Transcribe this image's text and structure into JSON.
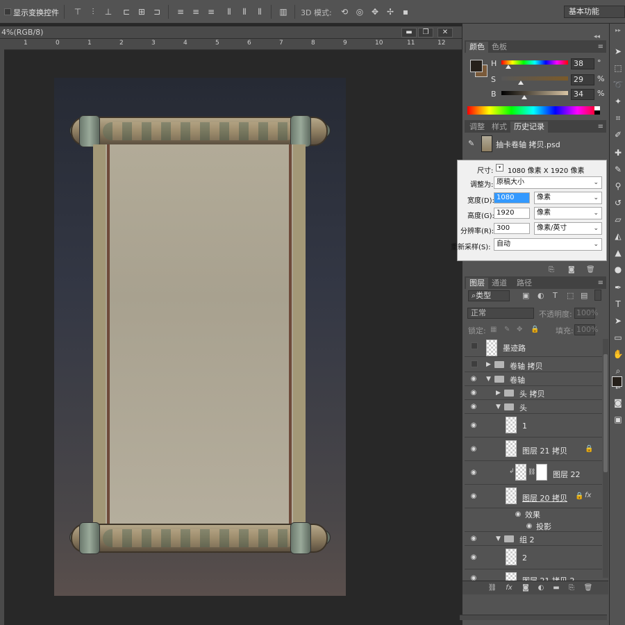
{
  "options_bar": {
    "show_transform_label": "显示变换控件",
    "mode_3d_label": "3D 模式:",
    "workspace": "基本功能"
  },
  "document": {
    "title_fragment": "4%(RGB/8)",
    "ruler_numbers": [
      "1",
      "0",
      "1",
      "2",
      "3",
      "4",
      "5",
      "6",
      "7",
      "8",
      "9",
      "10",
      "11",
      "12"
    ],
    "window_buttons": [
      "▬",
      "❐",
      "✕"
    ]
  },
  "color_panel": {
    "tabs": [
      "颜色",
      "色板"
    ],
    "sliders": [
      {
        "label": "H",
        "value": "38",
        "unit": "°",
        "position": 0.1
      },
      {
        "label": "S",
        "value": "29",
        "unit": "%",
        "position": 0.29
      },
      {
        "label": "B",
        "value": "34",
        "unit": "%",
        "position": 0.34
      }
    ],
    "foreground_color": "#26201a",
    "background_color": "#7a5a3a"
  },
  "history_panel": {
    "tabs": [
      "调整",
      "样式",
      "历史记录"
    ],
    "item": "抽卡卷轴 拷贝.psd"
  },
  "image_size_dialog": {
    "size_label": "尺寸:",
    "size_value": "1080 像素  X  1920 像素",
    "fit_label": "调整为:",
    "fit_value": "原稿大小",
    "width_label": "宽度(D):",
    "width_value": "1080",
    "width_unit": "像素",
    "height_label": "高度(G):",
    "height_value": "1920",
    "height_unit": "像素",
    "resolution_label": "分辨率(R):",
    "resolution_value": "300",
    "resolution_unit": "像素/英寸",
    "resample_label": "重新采样(S):",
    "resample_value": "自动"
  },
  "layers_panel": {
    "tabs": [
      "图层",
      "通道",
      "路径"
    ],
    "filter_label": "类型",
    "blend_mode": "正常",
    "opacity_label": "不透明度:",
    "opacity_value": "100%",
    "lock_label": "锁定:",
    "fill_label": "填充:",
    "fill_value": "100%",
    "layers": [
      {
        "name": "墨迹路",
        "visible": false,
        "type": "layer"
      },
      {
        "name": "卷轴 拷贝",
        "visible": false,
        "type": "group-closed"
      },
      {
        "name": "卷轴",
        "visible": true,
        "type": "group-open"
      },
      {
        "name": "头 拷贝",
        "visible": true,
        "type": "group-closed"
      },
      {
        "name": "头",
        "visible": true,
        "type": "group-open"
      },
      {
        "name": "1",
        "visible": true,
        "type": "layer"
      },
      {
        "name": "图层 21 拷贝",
        "visible": true,
        "type": "layer"
      },
      {
        "name": "图层 22",
        "visible": true,
        "type": "layer-mask"
      },
      {
        "name": "图层 20 拷贝",
        "visible": true,
        "type": "layer-fx"
      },
      {
        "name": "效果",
        "visible": true,
        "type": "effect"
      },
      {
        "name": "投影",
        "visible": true,
        "type": "effect"
      },
      {
        "name": "组 2",
        "visible": true,
        "type": "group-open"
      },
      {
        "name": "2",
        "visible": true,
        "type": "layer"
      },
      {
        "name": "图层 21 拷贝 2",
        "visible": true,
        "type": "layer"
      }
    ]
  }
}
